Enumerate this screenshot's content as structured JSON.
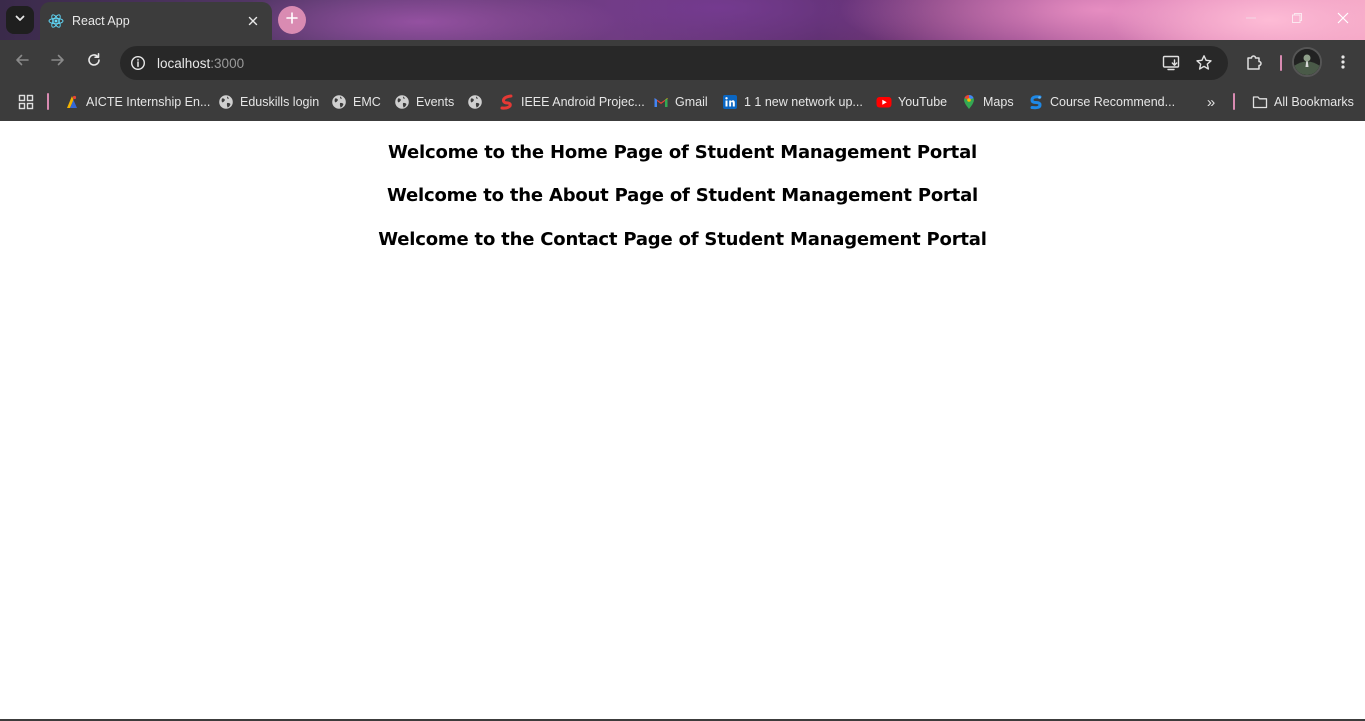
{
  "browser": {
    "tab": {
      "title": "React App"
    },
    "address_bar": {
      "host": "localhost",
      "port": ":3000"
    },
    "bookmarks": [
      {
        "label": "AICTE Internship En...",
        "icon": "aicte-icon"
      },
      {
        "label": "Eduskills login",
        "icon": "globe-icon"
      },
      {
        "label": "EMC",
        "icon": "globe-icon"
      },
      {
        "label": "Events",
        "icon": "globe-icon"
      },
      {
        "label": "",
        "icon": "globe-icon"
      },
      {
        "label": "IEEE Android Projec...",
        "icon": "ieee-icon"
      },
      {
        "label": "Gmail",
        "icon": "gmail-icon"
      },
      {
        "label": "1 1 new network up...",
        "icon": "linkedin-icon"
      },
      {
        "label": "YouTube",
        "icon": "youtube-icon"
      },
      {
        "label": "Maps",
        "icon": "maps-icon"
      },
      {
        "label": "Course Recommend...",
        "icon": "course-icon"
      }
    ],
    "all_bookmarks_label": "All Bookmarks"
  },
  "page": {
    "headings": [
      "Welcome to the Home Page of Student Management Portal",
      "Welcome to the About Page of Student Management Portal",
      "Welcome to the Contact Page of Student Management Portal"
    ]
  },
  "colors": {
    "toolbar_bg": "#3c3c3c",
    "omnibox_bg": "#282828",
    "accent_pink": "#d98bb2",
    "page_bg": "#ffffff",
    "heading_text": "#000000"
  }
}
